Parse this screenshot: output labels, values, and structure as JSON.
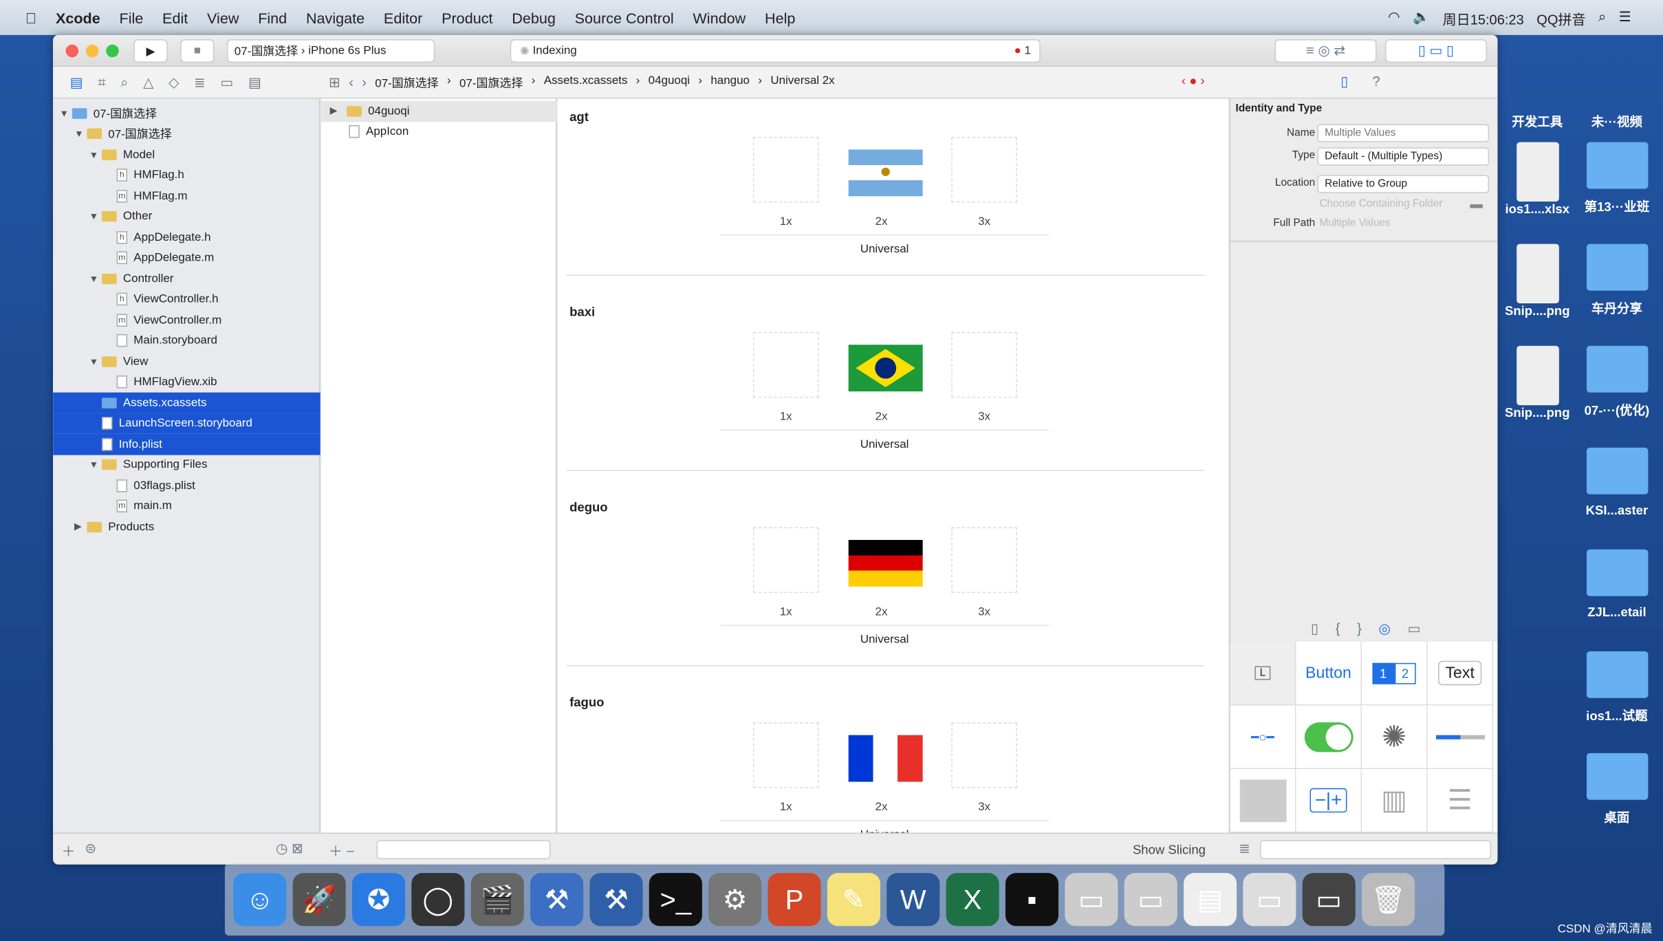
{
  "menubar": {
    "apple": "",
    "items": [
      "Xcode",
      "File",
      "Edit",
      "View",
      "Find",
      "Navigate",
      "Editor",
      "Product",
      "Debug",
      "Source Control",
      "Window",
      "Help"
    ],
    "clock": "周日15:06:23",
    "input_method": "QQ拼音"
  },
  "toolbar": {
    "scheme": "07-国旗选择",
    "device": "iPhone 6s Plus",
    "activity": "Indexing",
    "error_count": "1"
  },
  "breadcrumb": [
    "07-国旗选择",
    "07-国旗选择",
    "Assets.xcassets",
    "04guoqi",
    "hanguo",
    "Universal 2x"
  ],
  "navigator": {
    "rows": [
      {
        "label": "07-国旗选择",
        "depth": 0,
        "kind": "project",
        "open": true
      },
      {
        "label": "07-国旗选择",
        "depth": 1,
        "kind": "folder",
        "open": true
      },
      {
        "label": "Model",
        "depth": 2,
        "kind": "folder",
        "open": true
      },
      {
        "label": "HMFlag.h",
        "depth": 3,
        "kind": "h"
      },
      {
        "label": "HMFlag.m",
        "depth": 3,
        "kind": "m"
      },
      {
        "label": "Other",
        "depth": 2,
        "kind": "folder",
        "open": true
      },
      {
        "label": "AppDelegate.h",
        "depth": 3,
        "kind": "h"
      },
      {
        "label": "AppDelegate.m",
        "depth": 3,
        "kind": "m"
      },
      {
        "label": "Controller",
        "depth": 2,
        "kind": "folder",
        "open": true
      },
      {
        "label": "ViewController.h",
        "depth": 3,
        "kind": "h"
      },
      {
        "label": "ViewController.m",
        "depth": 3,
        "kind": "m"
      },
      {
        "label": "Main.storyboard",
        "depth": 3,
        "kind": "sb"
      },
      {
        "label": "View",
        "depth": 2,
        "kind": "folder",
        "open": true
      },
      {
        "label": "HMFlagView.xib",
        "depth": 3,
        "kind": "sb"
      },
      {
        "label": "Assets.xcassets",
        "depth": 2,
        "kind": "asset",
        "selected": true
      },
      {
        "label": "LaunchScreen.storyboard",
        "depth": 2,
        "kind": "sb",
        "selected": true
      },
      {
        "label": "Info.plist",
        "depth": 2,
        "kind": "plist",
        "selected": true
      },
      {
        "label": "Supporting Files",
        "depth": 2,
        "kind": "folder",
        "open": true
      },
      {
        "label": "03flags.plist",
        "depth": 3,
        "kind": "plist"
      },
      {
        "label": "main.m",
        "depth": 3,
        "kind": "m"
      },
      {
        "label": "Products",
        "depth": 1,
        "kind": "folder",
        "open": false
      }
    ]
  },
  "assets": {
    "items": [
      "04guoqi",
      "AppIcon"
    ]
  },
  "editor": {
    "scale_labels": [
      "1x",
      "2x",
      "3x"
    ],
    "idiom": "Universal",
    "sets": [
      {
        "name": "agt",
        "flag": "argentina"
      },
      {
        "name": "baxi",
        "flag": "brazil"
      },
      {
        "name": "deguo",
        "flag": "germany"
      },
      {
        "name": "faguo",
        "flag": "france"
      }
    ],
    "show_slicing": "Show Slicing"
  },
  "inspector": {
    "section": "Identity and Type",
    "name_label": "Name",
    "name_placeholder": "Multiple Values",
    "type_label": "Type",
    "type_value": "Default - (Multiple Types)",
    "location_label": "Location",
    "location_value": "Relative to Group",
    "choose_folder": "Choose Containing Folder",
    "fullpath_label": "Full Path",
    "fullpath_value": "Multiple Values",
    "library": {
      "label_item": "L",
      "button": "Button",
      "seg1": "1",
      "seg2": "2",
      "text": "Text"
    }
  },
  "desktop": {
    "items": [
      "开发工具",
      "未···视频",
      "ios1....xlsx",
      "第13···业班",
      "Snip....png",
      "车丹分享",
      "Snip....png",
      "07-···(优化)",
      "KSI...aster",
      "ZJL...etail",
      "ios1...试题",
      "桌面"
    ]
  },
  "dock": [
    "finder",
    "launchpad",
    "safari",
    "mouse",
    "movie",
    "xcode",
    "instruments",
    "terminal",
    "system-preferences",
    "powerpoint",
    "notes",
    "word",
    "excel",
    "console",
    "preview",
    "preview2",
    "textedit",
    "screenshot",
    "screen",
    "trash"
  ],
  "watermark": "CSDN @清风清晨",
  "colors": {
    "selection": "#1b55d4",
    "accent": "#1f6fe8"
  }
}
